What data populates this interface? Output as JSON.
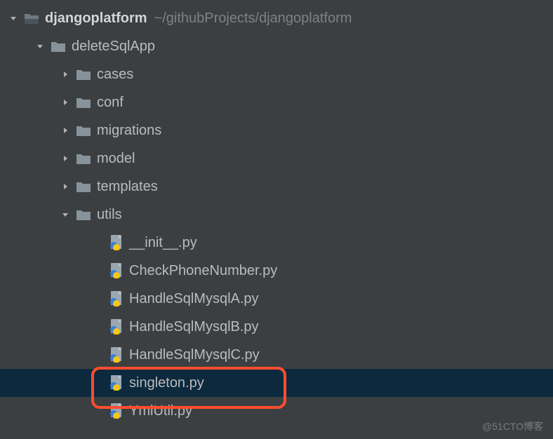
{
  "root": {
    "name": "djangoplatform",
    "path": "~/githubProjects/djangoplatform"
  },
  "folders": {
    "deleteSqlApp": "deleteSqlApp",
    "cases": "cases",
    "conf": "conf",
    "migrations": "migrations",
    "model": "model",
    "templates": "templates",
    "utils": "utils"
  },
  "files": {
    "init": "__init__.py",
    "checkPhone": "CheckPhoneNumber.py",
    "handleA": "HandleSqlMysqlA.py",
    "handleB": "HandleSqlMysqlB.py",
    "handleC": "HandleSqlMysqlC.py",
    "singleton": "singleton.py",
    "ymlutil": "YmlUtil.py"
  },
  "watermark": "@51CTO博客"
}
